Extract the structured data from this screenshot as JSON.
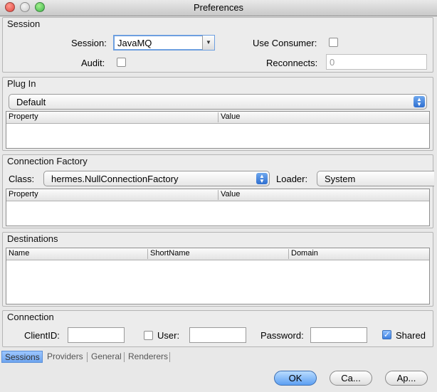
{
  "window": {
    "title": "Preferences"
  },
  "session_panel": {
    "title": "Session",
    "session_label": "Session:",
    "session_value": "JavaMQ",
    "use_consumer_label": "Use Consumer:",
    "audit_label": "Audit:",
    "reconnects_label": "Reconnects:",
    "reconnects_value": "0"
  },
  "plugin_panel": {
    "title": "Plug In",
    "selected": "Default",
    "columns": [
      "Property",
      "Value"
    ]
  },
  "connection_factory_panel": {
    "title": "Connection Factory",
    "class_label": "Class:",
    "class_value": "hermes.NullConnectionFactory",
    "loader_label": "Loader:",
    "loader_value": "System",
    "columns": [
      "Property",
      "Value"
    ]
  },
  "destinations_panel": {
    "title": "Destinations",
    "columns": [
      "Name",
      "ShortName",
      "Domain"
    ]
  },
  "connection_panel": {
    "title": "Connection",
    "clientid_label": "ClientID:",
    "user_label": "User:",
    "password_label": "Password:",
    "shared_label": "Shared",
    "shared_checked": true
  },
  "tabs": [
    "Sessions",
    "Providers",
    "General",
    "Renderers"
  ],
  "buttons": {
    "ok": "OK",
    "cancel": "Ca...",
    "apply": "Ap..."
  },
  "colors": {
    "accent": "#5d9ff2",
    "close": "#e0443e",
    "minimize": "#d0d0d0",
    "zoom": "#3cb54a"
  }
}
